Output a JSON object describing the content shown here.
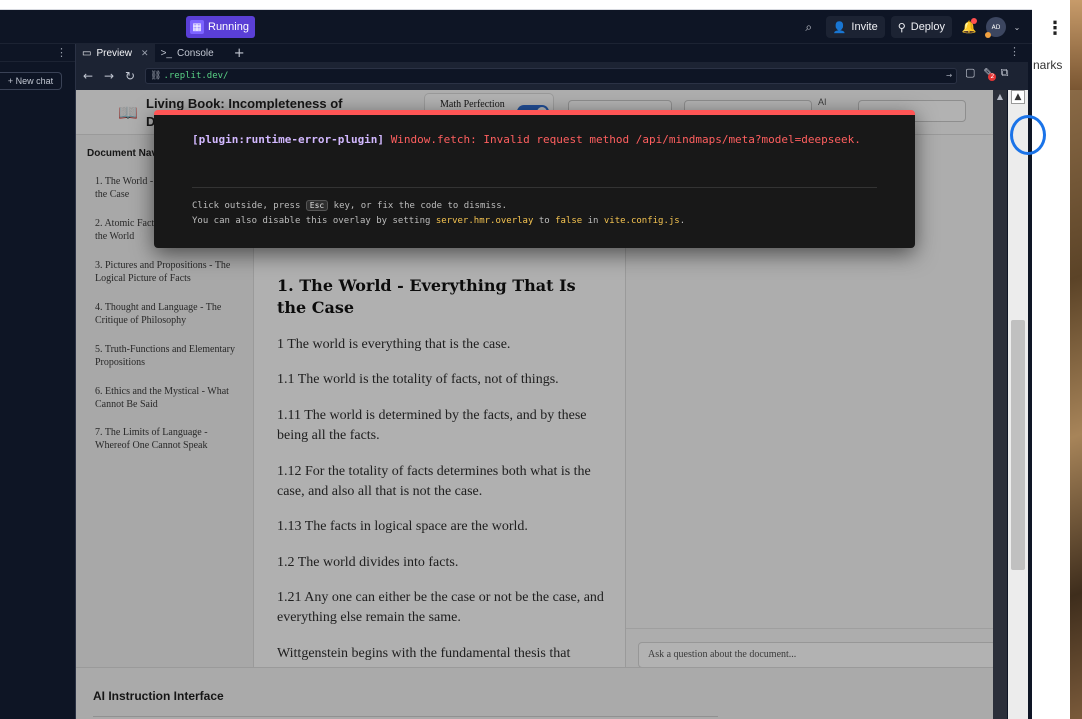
{
  "header": {
    "status": "Running",
    "invite": "Invite",
    "deploy": "Deploy",
    "avatar_initials": "AD"
  },
  "left_panel": {
    "new_chat": "+ New chat"
  },
  "tabs": [
    {
      "label": "Preview",
      "active": true
    },
    {
      "label": "Console",
      "active": false
    }
  ],
  "address": {
    "url": ".replit.dev/",
    "badge_count": "2"
  },
  "preview": {
    "title": "Living Book: Incompleteness of Deductive L",
    "math_toggle_label": "Math Perfection",
    "ai_label": "AI",
    "nav_heading": "Document Nav",
    "nav_items": [
      "1. The World - Everything That Is the Case",
      "2. Atomic Facts - The Substance of the World",
      "3. Pictures and Propositions - The Logical Picture of Facts",
      "4. Thought and Language - The Critique of Philosophy",
      "5. Truth-Functions and Elementary Propositions",
      "6. Ethics and the Mystical - What Cannot Be Said",
      "7. The Limits of Language - Whereof One Cannot Speak"
    ],
    "section_title": "1. The World - Everything That Is the Case",
    "paragraphs": [
      "1 The world is everything that is the case.",
      "1.1 The world is the totality of facts, not of things.",
      "1.11 The world is determined by the facts, and by these being all the facts.",
      "1.12 For the totality of facts determines both what is the case, and also all that is not the case.",
      "1.13 The facts in logical space are the world.",
      "1.2 The world divides into facts.",
      "1.21 Any one can either be the case or not be the case, and everything else remain the same.",
      "Wittgenstein begins with the fundamental thesis that"
    ],
    "ask_placeholder": "Ask a question about the document...",
    "bottom_heading": "AI Instruction Interface"
  },
  "error_overlay": {
    "plugin": "[plugin:runtime-error-plugin]",
    "message": "Window.fetch: Invalid request method /api/mindmaps/meta?model=deepseek.",
    "tip1_a": "Click outside, press",
    "tip1_key": "Esc",
    "tip1_b": "key, or fix the code to dismiss.",
    "tip2_a": "You can also disable this overlay by setting",
    "tip2_code1": "server.hmr.overlay",
    "tip2_b": "to",
    "tip2_code2": "false",
    "tip2_c": "in",
    "tip2_code3": "vite.config.js",
    "tip2_d": "."
  },
  "chrome": {
    "bookmarks_partial": "narks"
  },
  "colors": {
    "accent": "#5a3fd6",
    "error": "#ff5555",
    "link_blue": "#2f6fd6"
  }
}
